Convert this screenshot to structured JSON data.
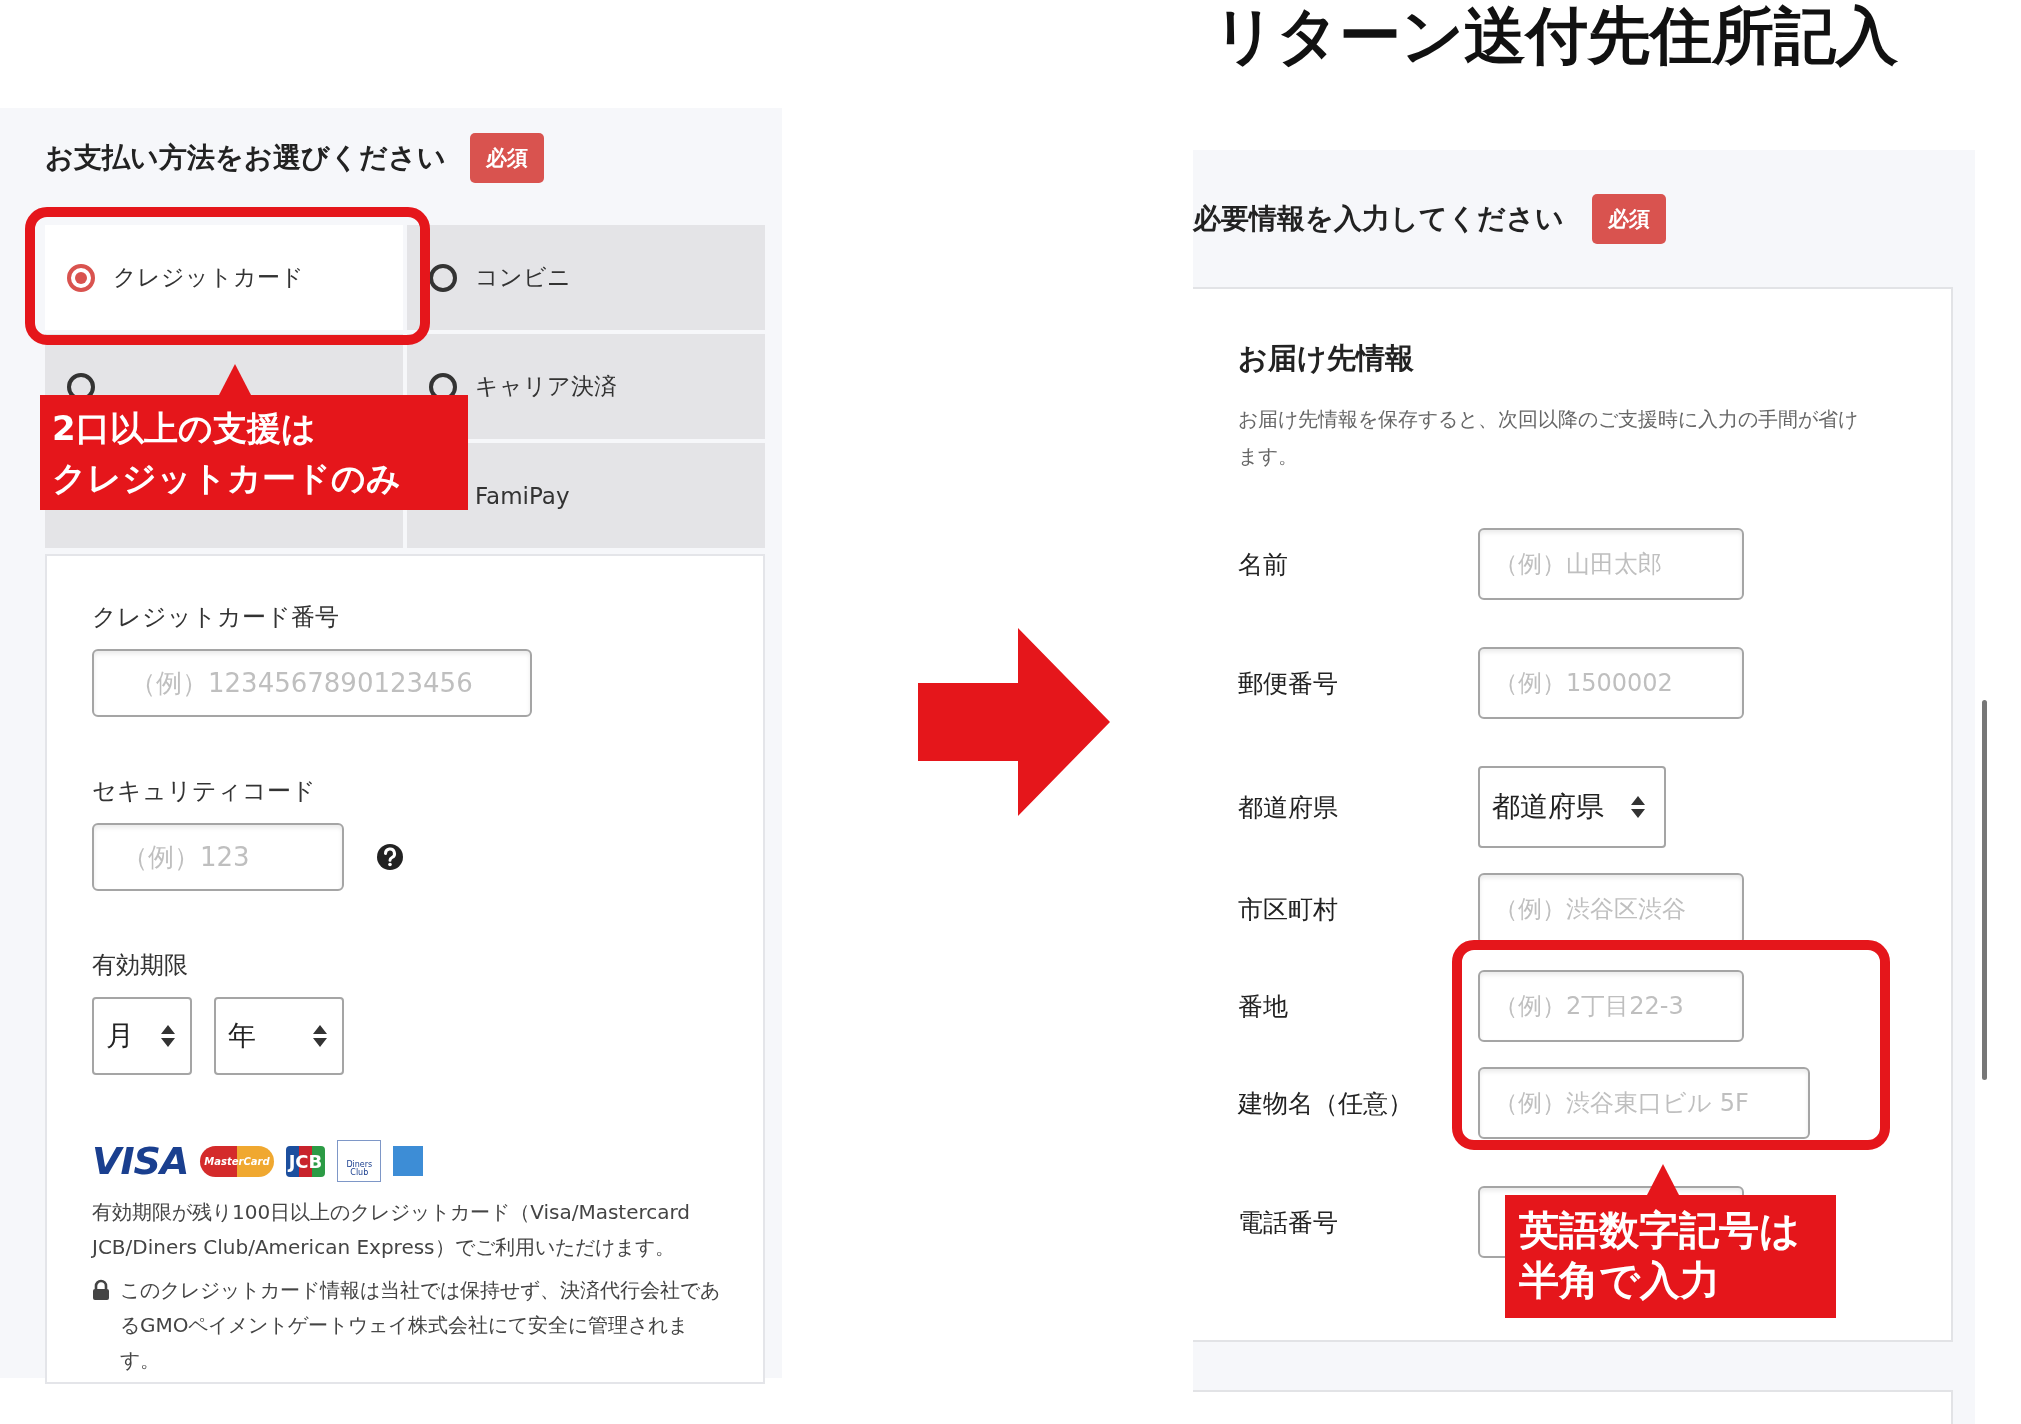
{
  "payment_panel": {
    "title": "お支払い方法をお選びください",
    "required_badge": "必須",
    "methods": [
      {
        "label": "クレジットカード",
        "selected": true
      },
      {
        "label": "コンビニ",
        "selected": false
      },
      {
        "selected": false
      },
      {
        "label": "キャリア決済",
        "selected": false
      },
      {
        "selected": false
      },
      {
        "label": "FamiPay",
        "selected": false
      }
    ],
    "card_form": {
      "fields": [
        {
          "label": "クレジットカード番号",
          "placeholder": "（例）1234567890123456",
          "kind": "wide"
        },
        {
          "label": "セキュリティコード",
          "placeholder": "（例）123",
          "kind": "short_help"
        }
      ],
      "expiry": {
        "label": "有効期限",
        "selects": [
          "月",
          "年"
        ]
      },
      "brands": [
        {
          "kind": "visa",
          "text": "VISA"
        },
        {
          "kind": "mastercard",
          "text": "MasterCard"
        },
        {
          "kind": "jcb",
          "text": "JCB"
        },
        {
          "kind": "diners",
          "text": "Diners Club"
        },
        {
          "kind": "amex"
        }
      ],
      "notice": "有効期限が残り100日以上のクレジットカード（Visa/Mastercard JCB/Diners Club/American Express）でご利用いただけます。",
      "security_note": "このクレジットカード情報は当社では保持せず、決済代行会社であるGMOペイメントゲートウェイ株式会社にて安全に管理されます。"
    },
    "callout": [
      "2口以上の支援は",
      "クレジットカードのみ"
    ]
  },
  "heading": "リターン送付先住所記入",
  "address_panel": {
    "title": "必要情報を入力してください",
    "required_badge": "必須",
    "section_title": "お届け先情報",
    "description": "お届け先情報を保存すると、次回以降のご支援時に入力の手間が省けます。",
    "rows": [
      {
        "label": "名前",
        "kind": "input",
        "placeholder": "（例）山田太郎"
      },
      {
        "label": "郵便番号",
        "kind": "input",
        "placeholder": "（例）1500002"
      },
      {
        "label": "都道府県",
        "kind": "select",
        "value": "都道府県"
      },
      {
        "label": "市区町村",
        "kind": "input",
        "placeholder": "（例）渋谷区渋谷"
      },
      {
        "label": "番地",
        "kind": "input",
        "placeholder": "（例）2丁目22-3"
      },
      {
        "label": "建物名（任意）",
        "kind": "input_wide",
        "placeholder": "（例）渋谷東口ビル 5F"
      },
      {
        "label": "電話番号",
        "kind": "input"
      }
    ],
    "callout": [
      "英語数字記号は",
      "半角で入力"
    ]
  }
}
